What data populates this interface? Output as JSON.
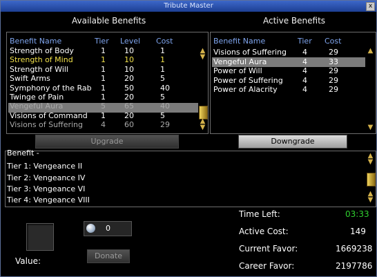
{
  "window": {
    "title": "Tribute Master",
    "close_glyph": "x"
  },
  "available": {
    "section_title": "Available Benefits",
    "headers": {
      "name": "Benefit Name",
      "tier": "Tier",
      "level": "Level",
      "cost": "Cost"
    },
    "rows": [
      {
        "name": "Strength of Body",
        "tier": "1",
        "level": "10",
        "cost": "1",
        "color": "#ffffff"
      },
      {
        "name": "Strength of Mind",
        "tier": "1",
        "level": "10",
        "cost": "1",
        "color": "#f0e04a"
      },
      {
        "name": "Strength of Will",
        "tier": "1",
        "level": "10",
        "cost": "1",
        "color": "#ffffff"
      },
      {
        "name": "Swift Arms",
        "tier": "1",
        "level": "20",
        "cost": "5",
        "color": "#ffffff"
      },
      {
        "name": "Symphony of the Rab",
        "tier": "1",
        "level": "50",
        "cost": "40",
        "color": "#ffffff"
      },
      {
        "name": "Twinge of Pain",
        "tier": "1",
        "level": "20",
        "cost": "5",
        "color": "#ffffff"
      },
      {
        "name": "Vengeful Aura",
        "tier": "5",
        "level": "65",
        "cost": "40",
        "color": "#a9a9a9",
        "selected": true
      },
      {
        "name": "Visions of Command",
        "tier": "1",
        "level": "20",
        "cost": "5",
        "color": "#ffffff"
      },
      {
        "name": "Visions of Suffering",
        "tier": "4",
        "level": "60",
        "cost": "29",
        "color": "#a9a9a9"
      }
    ],
    "upgrade_label": "Upgrade"
  },
  "active": {
    "section_title": "Active Benefits",
    "headers": {
      "name": "Benefit Name",
      "tier": "Tier",
      "cost": "Cost"
    },
    "rows": [
      {
        "name": "Visions of Suffering",
        "tier": "4",
        "cost": "29"
      },
      {
        "name": "Vengeful Aura",
        "tier": "4",
        "cost": "33",
        "selected": true
      },
      {
        "name": "Power of Will",
        "tier": "4",
        "cost": "29"
      },
      {
        "name": "Power of Suffering",
        "tier": "4",
        "cost": "29"
      },
      {
        "name": "Power of Alacrity",
        "tier": "4",
        "cost": "29"
      }
    ],
    "downgrade_label": "Downgrade"
  },
  "description": {
    "lines": [
      "Benefit -",
      "Tier 1: Vengeance II",
      "Tier 2: Vengeance IV",
      "Tier 3: Vengeance VI",
      "Tier 4: Vengeance VIII"
    ]
  },
  "donate": {
    "value_label": "Value:",
    "amount": "0",
    "donate_label": "Donate"
  },
  "stats": {
    "time_left_label": "Time Left:",
    "time_left": "03:33",
    "time_left_color": "#2fd02f",
    "active_cost_label": "Active Cost:",
    "active_cost": "149",
    "current_favor_label": "Current Favor:",
    "current_favor": "1669238",
    "career_favor_label": "Career Favor:",
    "career_favor": "2197786"
  },
  "icons": {
    "scroll_up": "▲",
    "scroll_down": "▼",
    "platinum_coin": "platinum-coin-icon"
  }
}
